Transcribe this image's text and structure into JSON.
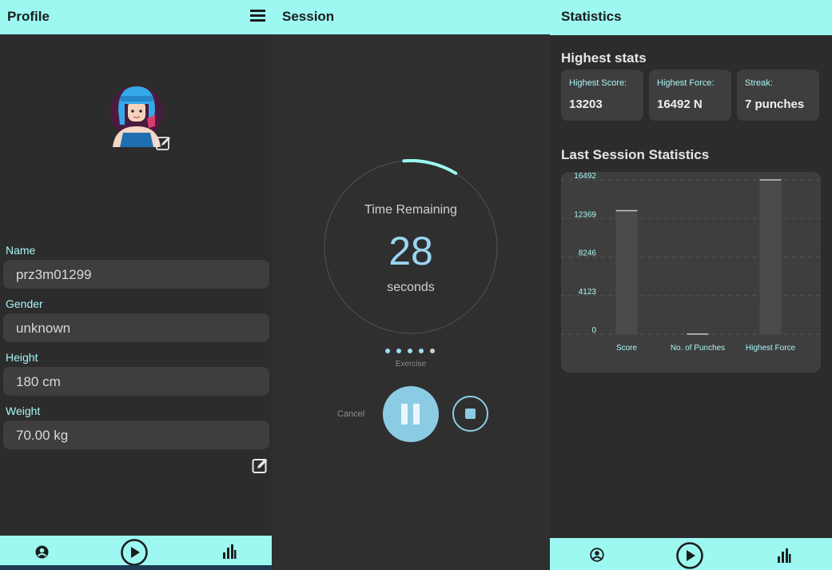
{
  "profile": {
    "title": "Profile",
    "fields": [
      {
        "label": "Name",
        "value": "prz3m01299"
      },
      {
        "label": "Gender",
        "value": "unknown"
      },
      {
        "label": "Height",
        "value": "180 cm"
      },
      {
        "label": "Weight",
        "value": "70.00 kg"
      }
    ],
    "icons": [
      "menu-icon",
      "avatar",
      "edit-photo-icon",
      "edit-icon"
    ],
    "nav": [
      "profile-icon",
      "play-icon",
      "statistics-icon"
    ]
  },
  "session": {
    "title": "Session",
    "time_label": "Time Remaining",
    "time_value": "28",
    "time_unit": "seconds",
    "exercise_label": "Exercise",
    "cancel_label": "Cancel",
    "dots_total": 5,
    "dots_active": 4,
    "timer_progress": 0.1
  },
  "statistics": {
    "title": "Statistics",
    "highest_title": "Highest stats",
    "cards": [
      {
        "label": "Highest Score:",
        "value": "13203"
      },
      {
        "label": "Highest Force:",
        "value": "16492 N"
      },
      {
        "label": "Streak:",
        "value": "7 punches"
      }
    ],
    "last_title": "Last Session Statistics",
    "nav": [
      "profile-icon",
      "play-icon",
      "statistics-icon"
    ]
  },
  "colors": {
    "accent": "#9cf8f1",
    "background": "#2c2c2d",
    "card": "#3e3e3f",
    "button": "#8ccbe4"
  },
  "chart_data": {
    "type": "bar",
    "categories": [
      "Score",
      "No. of Punches",
      "Highest Force"
    ],
    "values": [
      13203,
      7,
      16492
    ],
    "yticks": [
      "16492",
      "12369",
      "8246",
      "4123",
      "0"
    ],
    "ylim": [
      0,
      16492
    ],
    "grid": true,
    "title": "",
    "xlabel": "",
    "ylabel": ""
  }
}
